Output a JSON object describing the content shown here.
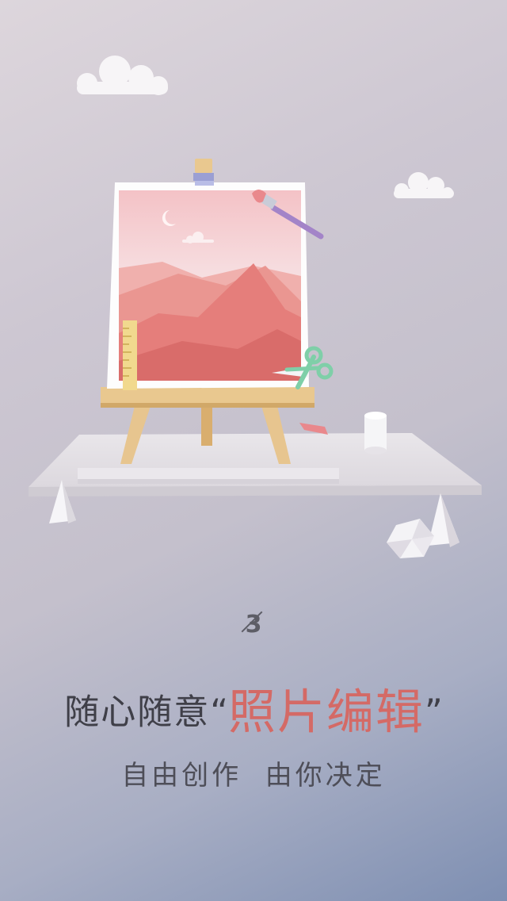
{
  "page": {
    "number": "3",
    "headline_lead": "随心随意",
    "quote_open": "“",
    "headline_highlight": "照片编辑",
    "quote_close": "”",
    "subtitle": "自由创作  由你决定"
  },
  "colors": {
    "highlight": "#d46a66",
    "text_dark": "#3f3f48",
    "canvas_pink": "#f3b3b3",
    "easel_wood": "#e7c58f",
    "scissors_green": "#7fcfa8",
    "brush_purple": "#a384c8"
  },
  "illustration": {
    "icons": [
      "cloud-icon",
      "easel-icon",
      "canvas-painting-icon",
      "paintbrush-icon",
      "scissors-icon",
      "ruler-icon",
      "pencil-eraser-icon",
      "cylinder-icon",
      "cone-icon",
      "polyhedron-icon"
    ]
  }
}
